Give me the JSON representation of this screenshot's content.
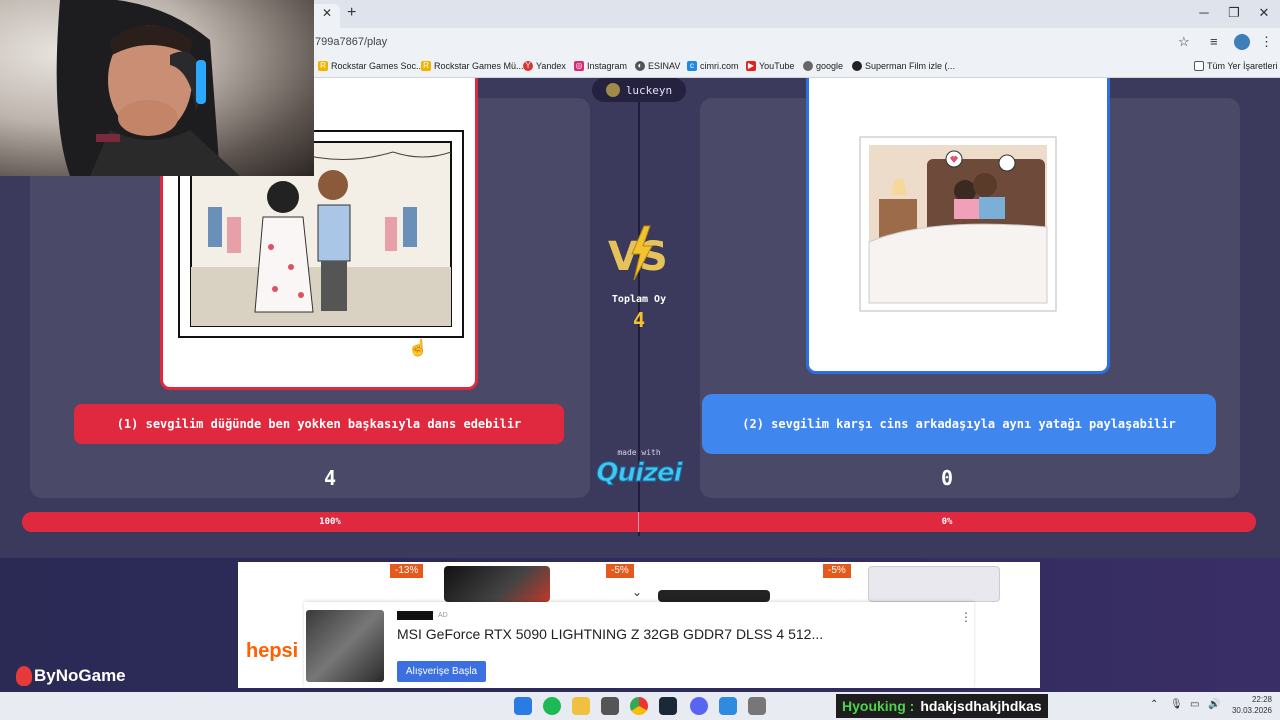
{
  "browser": {
    "url": "799a7867/play",
    "bookmarks": [
      {
        "label": "Rockstar Games Soc...",
        "color": "#f0b400"
      },
      {
        "label": "Rockstar Games Mü...",
        "color": "#f0b400"
      },
      {
        "label": "Yandex",
        "color": "#e03030"
      },
      {
        "label": "Instagram",
        "color": "#d62976"
      },
      {
        "label": "ESINAV",
        "color": "#555555"
      },
      {
        "label": "cimri.com",
        "color": "#1e88e5"
      },
      {
        "label": "YouTube",
        "color": "#e62117"
      },
      {
        "label": "google",
        "color": "#666666"
      },
      {
        "label": "Superman Film izle (...",
        "color": "#222222"
      }
    ],
    "bookmarks_folder": "Tüm Yer İşaretleri"
  },
  "game": {
    "username": "luckeyn",
    "total_label": "Toplam Oy",
    "total_votes": "4",
    "option_left": {
      "text": "(1) sevgilim düğünde ben yokken başkasıyla dans edebilir",
      "votes": "4",
      "percent_text": "100%",
      "share": 1.0,
      "color": "#e0283e"
    },
    "option_right": {
      "text": "(2) sevgilim karşı cins arkadaşıyla aynı yatağı paylaşabilir",
      "votes": "0",
      "percent_text": "0%",
      "share": 0.0,
      "color": "#2f6fe0"
    },
    "made_with": "made with",
    "brand": "Quizei"
  },
  "ad": {
    "discounts": [
      "-13%",
      "-5%",
      "-5%"
    ],
    "store": "hepsi",
    "tag": "AD",
    "title": "MSI GeForce RTX 5090 LIGHTNING Z 32GB GDDR7 DLSS 4 512...",
    "cta": "Alışverişe Başla"
  },
  "overlay": {
    "sponsor": "ByNoGame",
    "chat_user": "Hyouking :",
    "chat_message": "hdakjsdhakjhdkas"
  },
  "taskbar": {
    "time": "22:28",
    "date": "30.03.2026"
  }
}
